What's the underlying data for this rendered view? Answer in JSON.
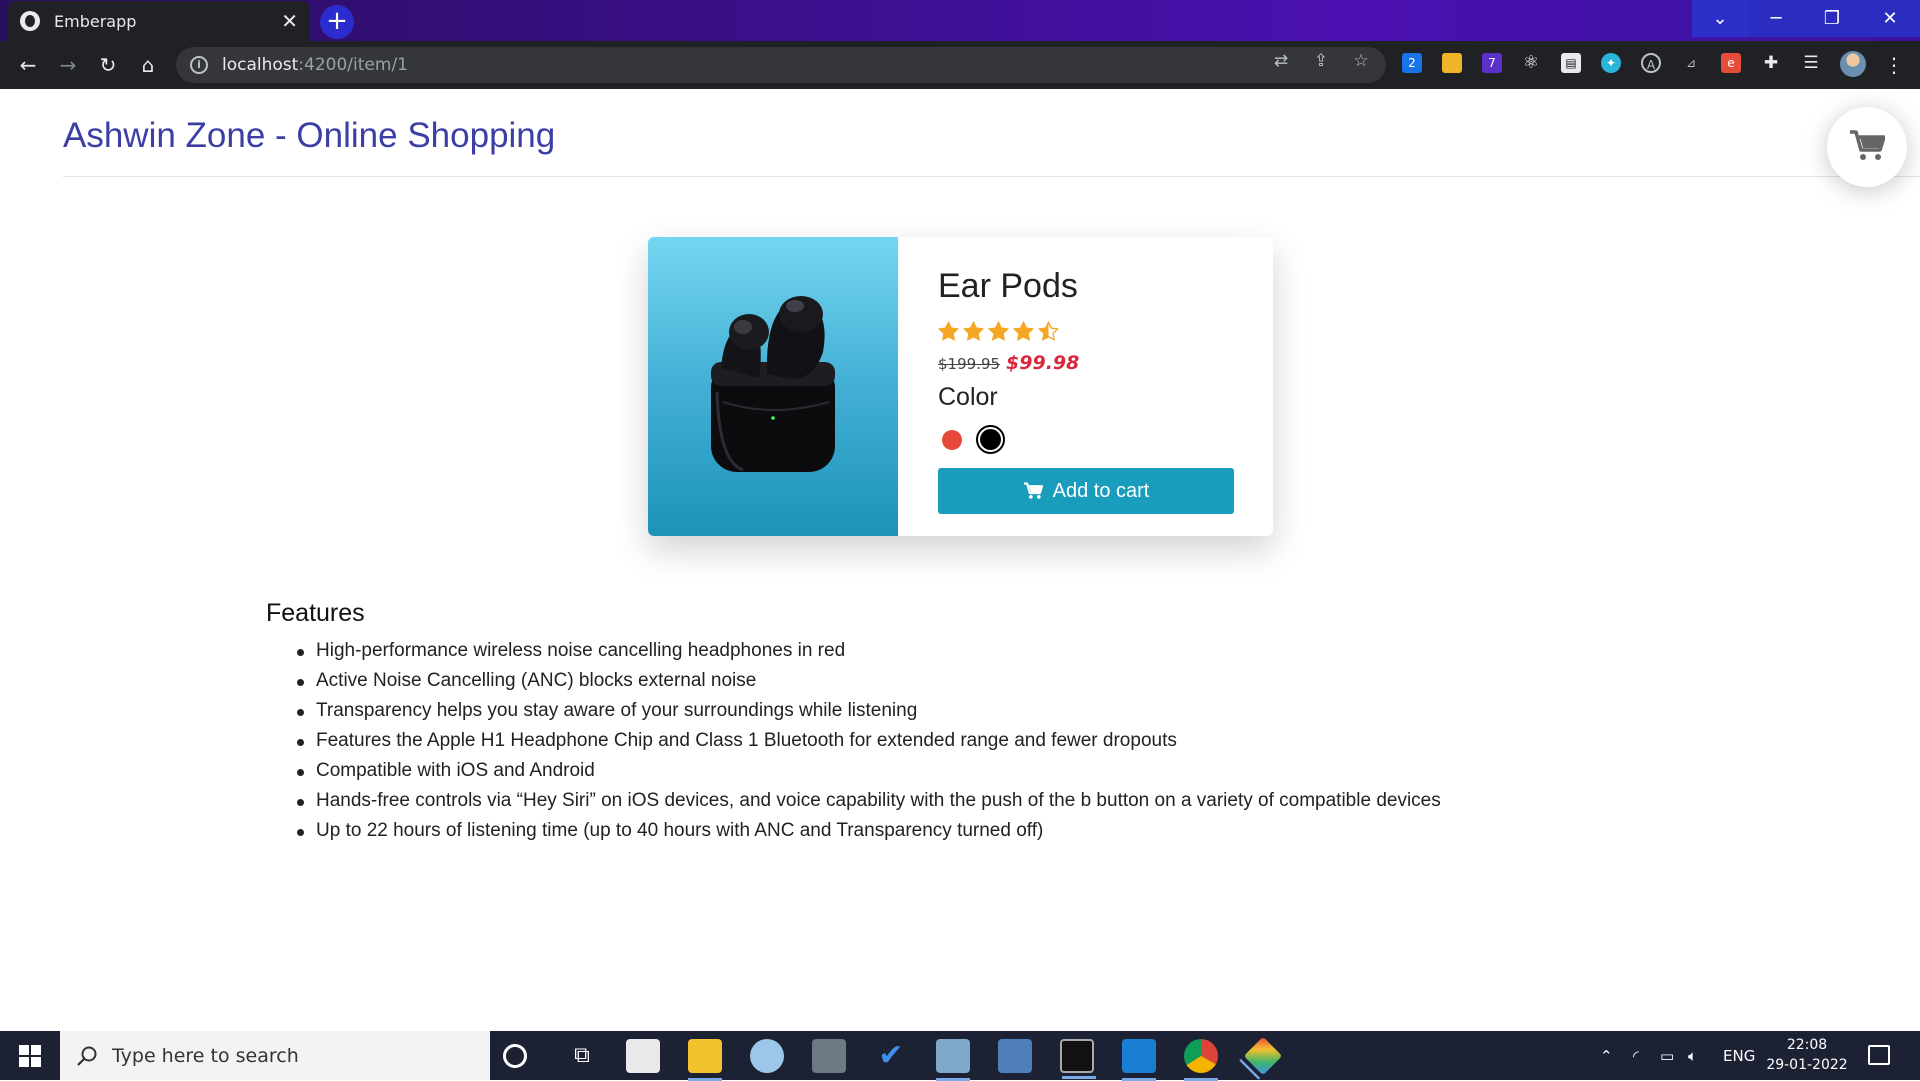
{
  "browser": {
    "tab_title": "Emberapp",
    "tab_close": "✕",
    "new_tab": "+",
    "url_host": "localhost",
    "url_path": ":4200/item/1",
    "extension_badge": "7",
    "extension_count": "2"
  },
  "header": {
    "brand": "Ashwin Zone - Online Shopping"
  },
  "product": {
    "name": "Ear Pods",
    "rating": 4.5,
    "rating_max": 5,
    "old_price": "$199.95",
    "new_price": "$99.98",
    "color_label": "Color",
    "colors": [
      {
        "name": "red",
        "hex": "#e8473b",
        "selected": false
      },
      {
        "name": "black",
        "hex": "#000000",
        "selected": true
      }
    ],
    "add_to_cart": "Add to cart"
  },
  "features": {
    "title": "Features",
    "items": [
      "High-performance wireless noise cancelling headphones in red",
      "Active Noise Cancelling (ANC) blocks external noise",
      "Transparency helps you stay aware of your surroundings while listening",
      "Features the Apple H1 Headphone Chip and Class 1 Bluetooth for extended range and fewer dropouts",
      "Compatible with iOS and Android",
      "Hands-free controls via “Hey Siri” on iOS devices, and voice capability with the push of the b button on a variety of compatible devices",
      "Up to 22 hours of listening time (up to 40 hours with ANC and Transparency turned off)"
    ]
  },
  "taskbar": {
    "search_placeholder": "Type here to search",
    "language": "ENG",
    "time": "22:08",
    "date": "29-01-2022"
  },
  "colors": {
    "brand": "#3b3fa5",
    "accent": "#1a9dbd",
    "sale": "#d9273b",
    "star": "#f5a623"
  }
}
